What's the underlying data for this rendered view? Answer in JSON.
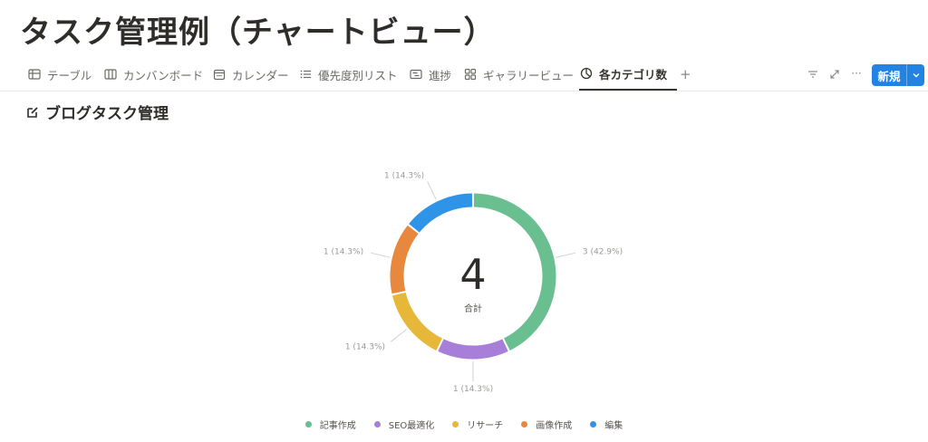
{
  "page": {
    "title": "タスク管理例（チャートビュー）"
  },
  "tabs": [
    {
      "label": "テーブル",
      "icon": "table-icon"
    },
    {
      "label": "カンバンボード",
      "icon": "board-icon"
    },
    {
      "label": "カレンダー",
      "icon": "calendar-icon"
    },
    {
      "label": "優先度別リスト",
      "icon": "list-icon"
    },
    {
      "label": "進捗",
      "icon": "timeline-icon"
    },
    {
      "label": "ギャラリービュー",
      "icon": "gallery-icon"
    },
    {
      "label": "各カテゴリ数",
      "icon": "chart-icon",
      "active": true
    }
  ],
  "toolbar": {
    "add_view": "+",
    "filter_icon": "filter-icon",
    "expand_icon": "expand-icon",
    "more": "···",
    "new_label": "新規"
  },
  "section": {
    "title": "ブログタスク管理",
    "icon": "edit-icon"
  },
  "chart_data": {
    "type": "donut",
    "center_value": "4",
    "center_label": "合計",
    "slices": [
      {
        "name": "記事作成",
        "value": 3,
        "label": "3 (42.9%)",
        "color": "#69bf8f"
      },
      {
        "name": "SEO最適化",
        "value": 1,
        "label": "1 (14.3%)",
        "color": "#a77ed8"
      },
      {
        "name": "リサーチ",
        "value": 1,
        "label": "1 (14.3%)",
        "color": "#e7b73a"
      },
      {
        "name": "画像作成",
        "value": 1,
        "label": "1 (14.3%)",
        "color": "#e8883d"
      },
      {
        "name": "編集",
        "value": 1,
        "label": "1 (14.3%)",
        "color": "#2f93e8"
      }
    ]
  }
}
